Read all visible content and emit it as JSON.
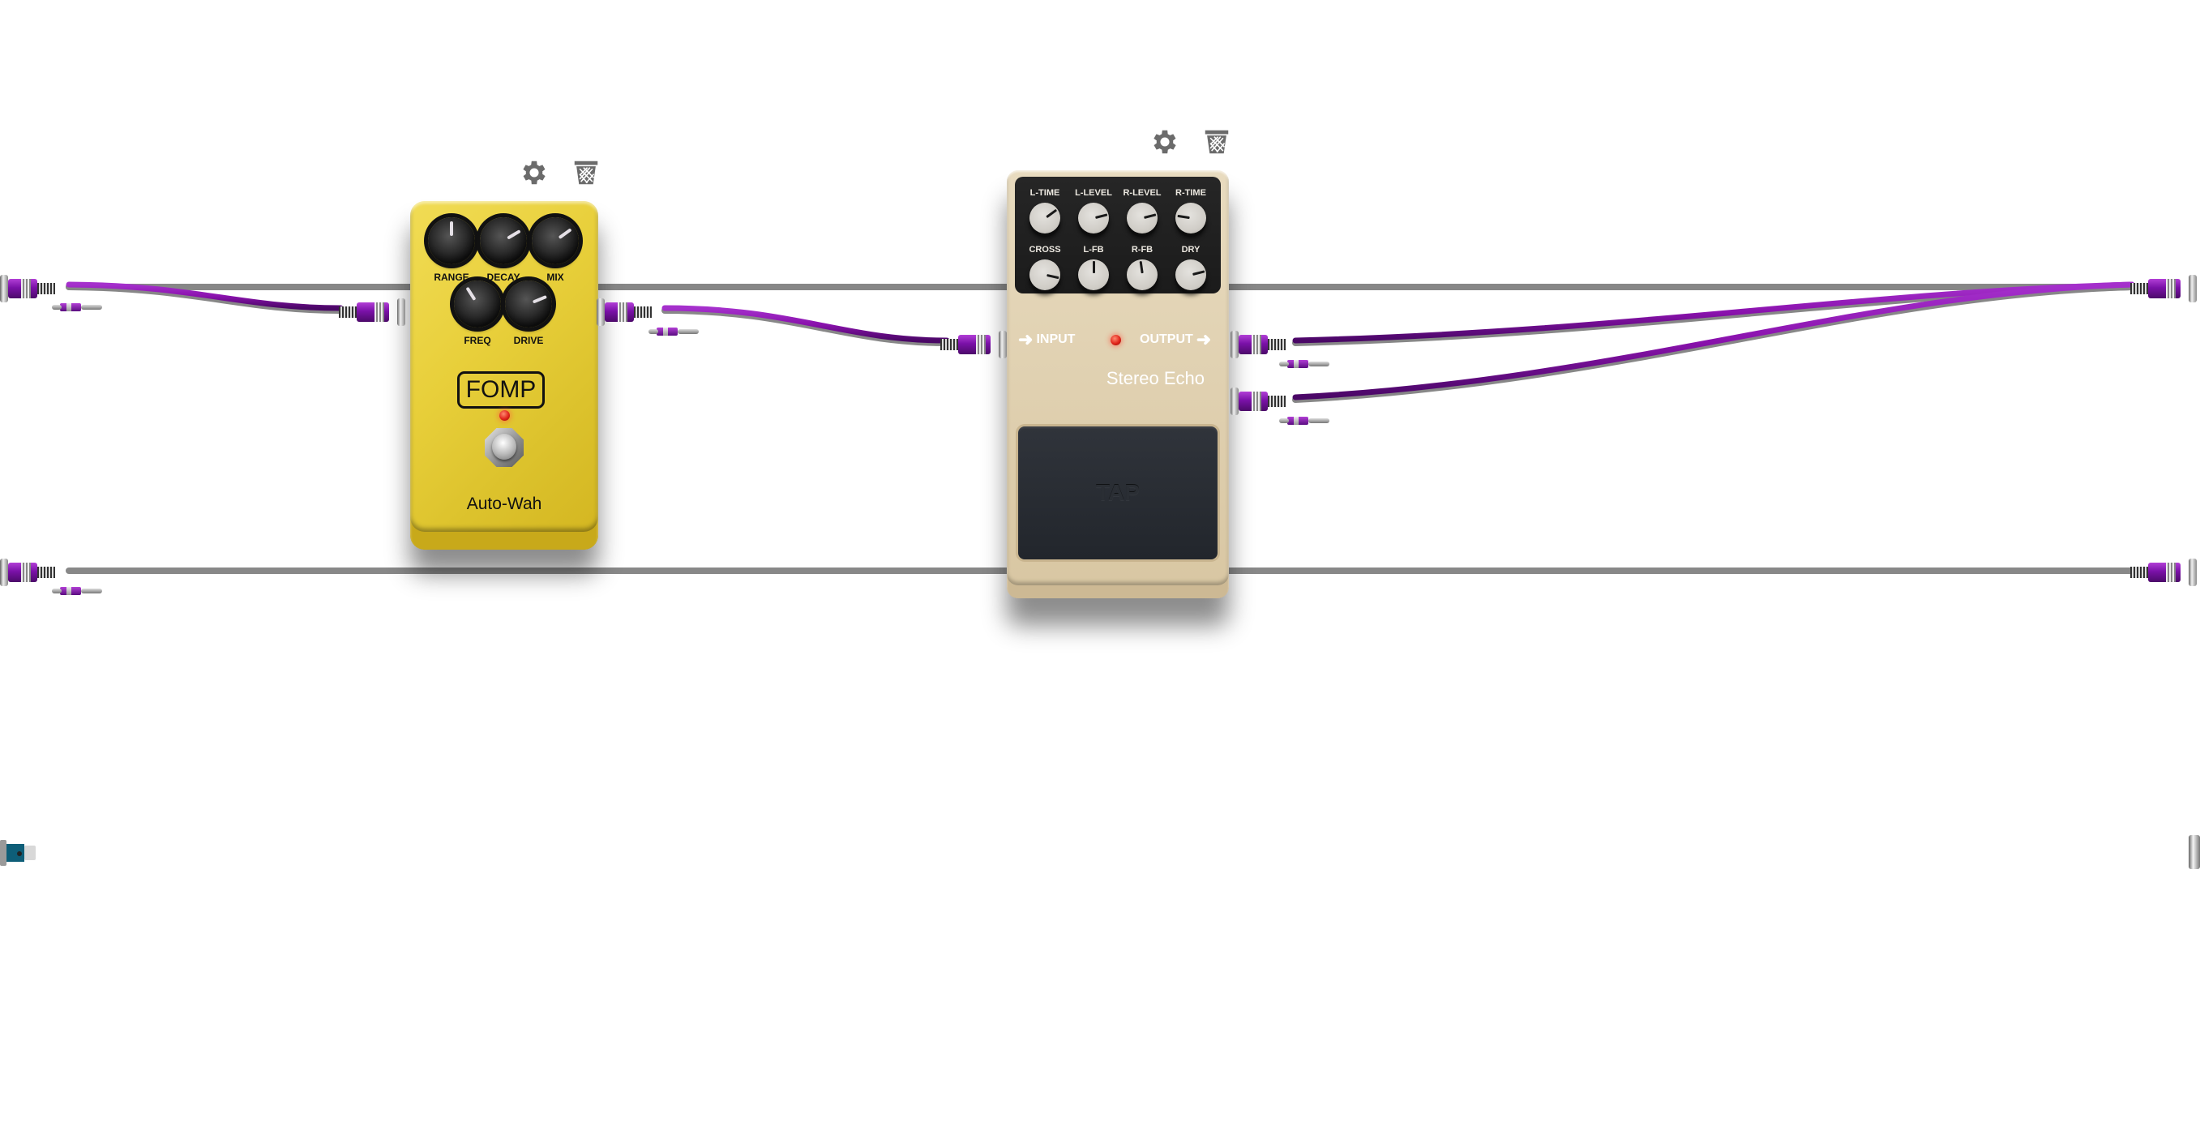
{
  "board": {
    "cable_color": "#8a1aa8",
    "pedals": [
      {
        "id": "autowah",
        "brand": "FOMP",
        "name": "Auto-Wah",
        "body_color": "#e6cc3a",
        "led_on": true,
        "knobs": [
          {
            "label": "RANGE",
            "value": 0.5
          },
          {
            "label": "DECAY",
            "value": 0.72
          },
          {
            "label": "MIX",
            "value": 0.7
          },
          {
            "label": "FREQ",
            "value": 0.38
          },
          {
            "label": "DRIVE",
            "value": 0.75
          }
        ],
        "tools": {
          "settings": "gear-icon",
          "delete": "trash-icon"
        }
      },
      {
        "id": "stereo-echo",
        "name": "Stereo Echo",
        "body_color": "#dccbaa",
        "input_label": "INPUT",
        "output_label": "OUTPUT",
        "tap_label": "TAP",
        "led_on": true,
        "knobs": [
          {
            "label": "L-TIME",
            "value": 0.7
          },
          {
            "label": "L-LEVEL",
            "value": 0.78
          },
          {
            "label": "R-LEVEL",
            "value": 0.78
          },
          {
            "label": "R-TIME",
            "value": 0.2
          },
          {
            "label": "CROSS",
            "value": 0.88
          },
          {
            "label": "L-FB",
            "value": 0.5
          },
          {
            "label": "R-FB",
            "value": 0.47
          },
          {
            "label": "DRY",
            "value": 0.78
          }
        ],
        "tools": {
          "settings": "gear-icon",
          "delete": "trash-icon"
        }
      }
    ]
  }
}
